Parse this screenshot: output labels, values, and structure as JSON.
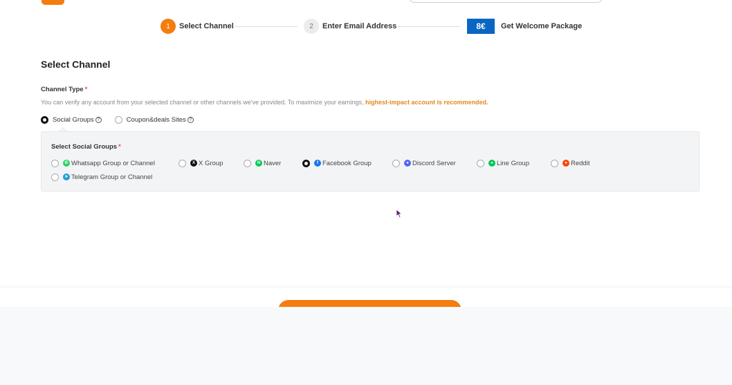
{
  "steps": [
    {
      "number": "1",
      "label": "Select Channel"
    },
    {
      "number": "2",
      "label": "Enter Email Address"
    },
    {
      "badge": "8€",
      "label": "Get Welcome Package"
    }
  ],
  "section": {
    "title": "Select Channel",
    "channel_type_label": "Channel Type",
    "required_mark": "*",
    "help_text": "You can verify any account from your selected channel or other channels we've provided. To maximize your earnings, ",
    "help_highlight": "highest-impact account is recommended."
  },
  "channel_types": [
    {
      "label": "Social Groups",
      "checked": true,
      "help_icon": "?"
    },
    {
      "label": "Coupon&deals Sites",
      "checked": false,
      "help_icon": "?"
    }
  ],
  "social_groups": {
    "label": "Select Social Groups",
    "required_mark": "*",
    "options": [
      {
        "label": "Whatsapp Group or Channel",
        "icon": "whatsapp-icon",
        "color": "#25d366",
        "glyph": "✆",
        "checked": false
      },
      {
        "label": "X Group",
        "icon": "x-icon",
        "color": "#111111",
        "glyph": "X",
        "checked": false
      },
      {
        "label": "Naver",
        "icon": "naver-icon",
        "color": "#03c75a",
        "glyph": "N",
        "checked": false
      },
      {
        "label": "Facebook Group",
        "icon": "facebook-icon",
        "color": "#1877f2",
        "glyph": "f",
        "checked": true
      },
      {
        "label": "Discord Server",
        "icon": "discord-icon",
        "color": "#5865f2",
        "glyph": "●",
        "checked": false
      },
      {
        "label": "Line Group",
        "icon": "line-icon",
        "color": "#06c755",
        "glyph": "●",
        "checked": false
      },
      {
        "label": "Reddit",
        "icon": "reddit-icon",
        "color": "#ff4500",
        "glyph": "●",
        "checked": false
      },
      {
        "label": "Telegram Group or Channel",
        "icon": "telegram-icon",
        "color": "#229ed9",
        "glyph": "➤",
        "checked": false
      }
    ]
  },
  "colors": {
    "accent": "#f57c0e",
    "badge": "#0a66c2",
    "highlight": "#e08a1e"
  }
}
